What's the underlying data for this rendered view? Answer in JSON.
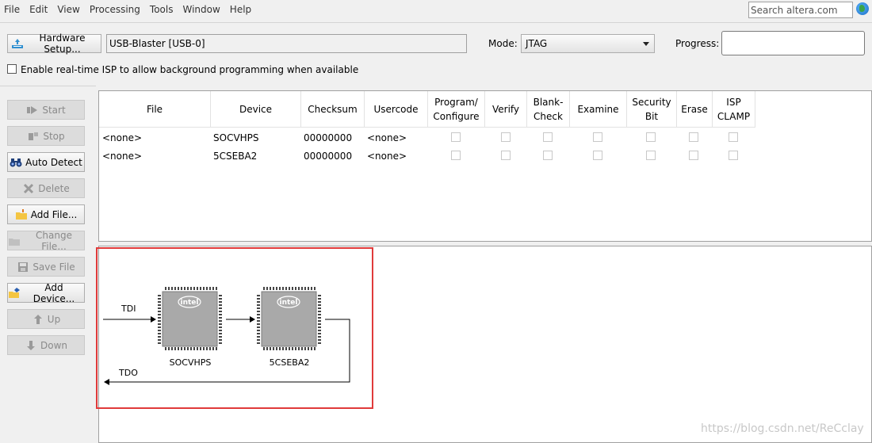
{
  "menu": [
    "File",
    "Edit",
    "View",
    "Processing",
    "Tools",
    "Window",
    "Help"
  ],
  "search": {
    "value": "Search altera.com"
  },
  "toolbar": {
    "hardware_setup_label": "Hardware Setup...",
    "hardware_value": "USB-Blaster [USB-0]",
    "mode_label": "Mode:",
    "mode_value": "JTAG",
    "progress_label": "Progress:",
    "isp_label": "Enable real-time ISP to allow background programming when available"
  },
  "sidebar": {
    "start": "Start",
    "stop": "Stop",
    "auto_detect": "Auto Detect",
    "delete": "Delete",
    "add_file": "Add File...",
    "change_file": "Change File...",
    "save_file": "Save File",
    "add_device": "Add Device...",
    "up": "Up",
    "down": "Down"
  },
  "table": {
    "headers": {
      "file": "File",
      "device": "Device",
      "checksum": "Checksum",
      "usercode": "Usercode",
      "program_l1": "Program/",
      "program_l2": "Configure",
      "verify": "Verify",
      "blank_l1": "Blank-",
      "blank_l2": "Check",
      "examine": "Examine",
      "security_l1": "Security",
      "security_l2": "Bit",
      "erase": "Erase",
      "isp_l1": "ISP",
      "isp_l2": "CLAMP"
    },
    "rows": [
      {
        "file": "<none>",
        "device": "SOCVHPS",
        "checksum": "00000000",
        "usercode": "<none>"
      },
      {
        "file": "<none>",
        "device": "5CSEBA2",
        "checksum": "00000000",
        "usercode": "<none>"
      }
    ]
  },
  "diagram": {
    "tdi": "TDI",
    "tdo": "TDO",
    "chip_logo": "intel",
    "chips": [
      "SOCVHPS",
      "5CSEBA2"
    ],
    "highlight_color": "#e03a3a"
  },
  "watermark": "https://blog.csdn.net/ReCclay"
}
